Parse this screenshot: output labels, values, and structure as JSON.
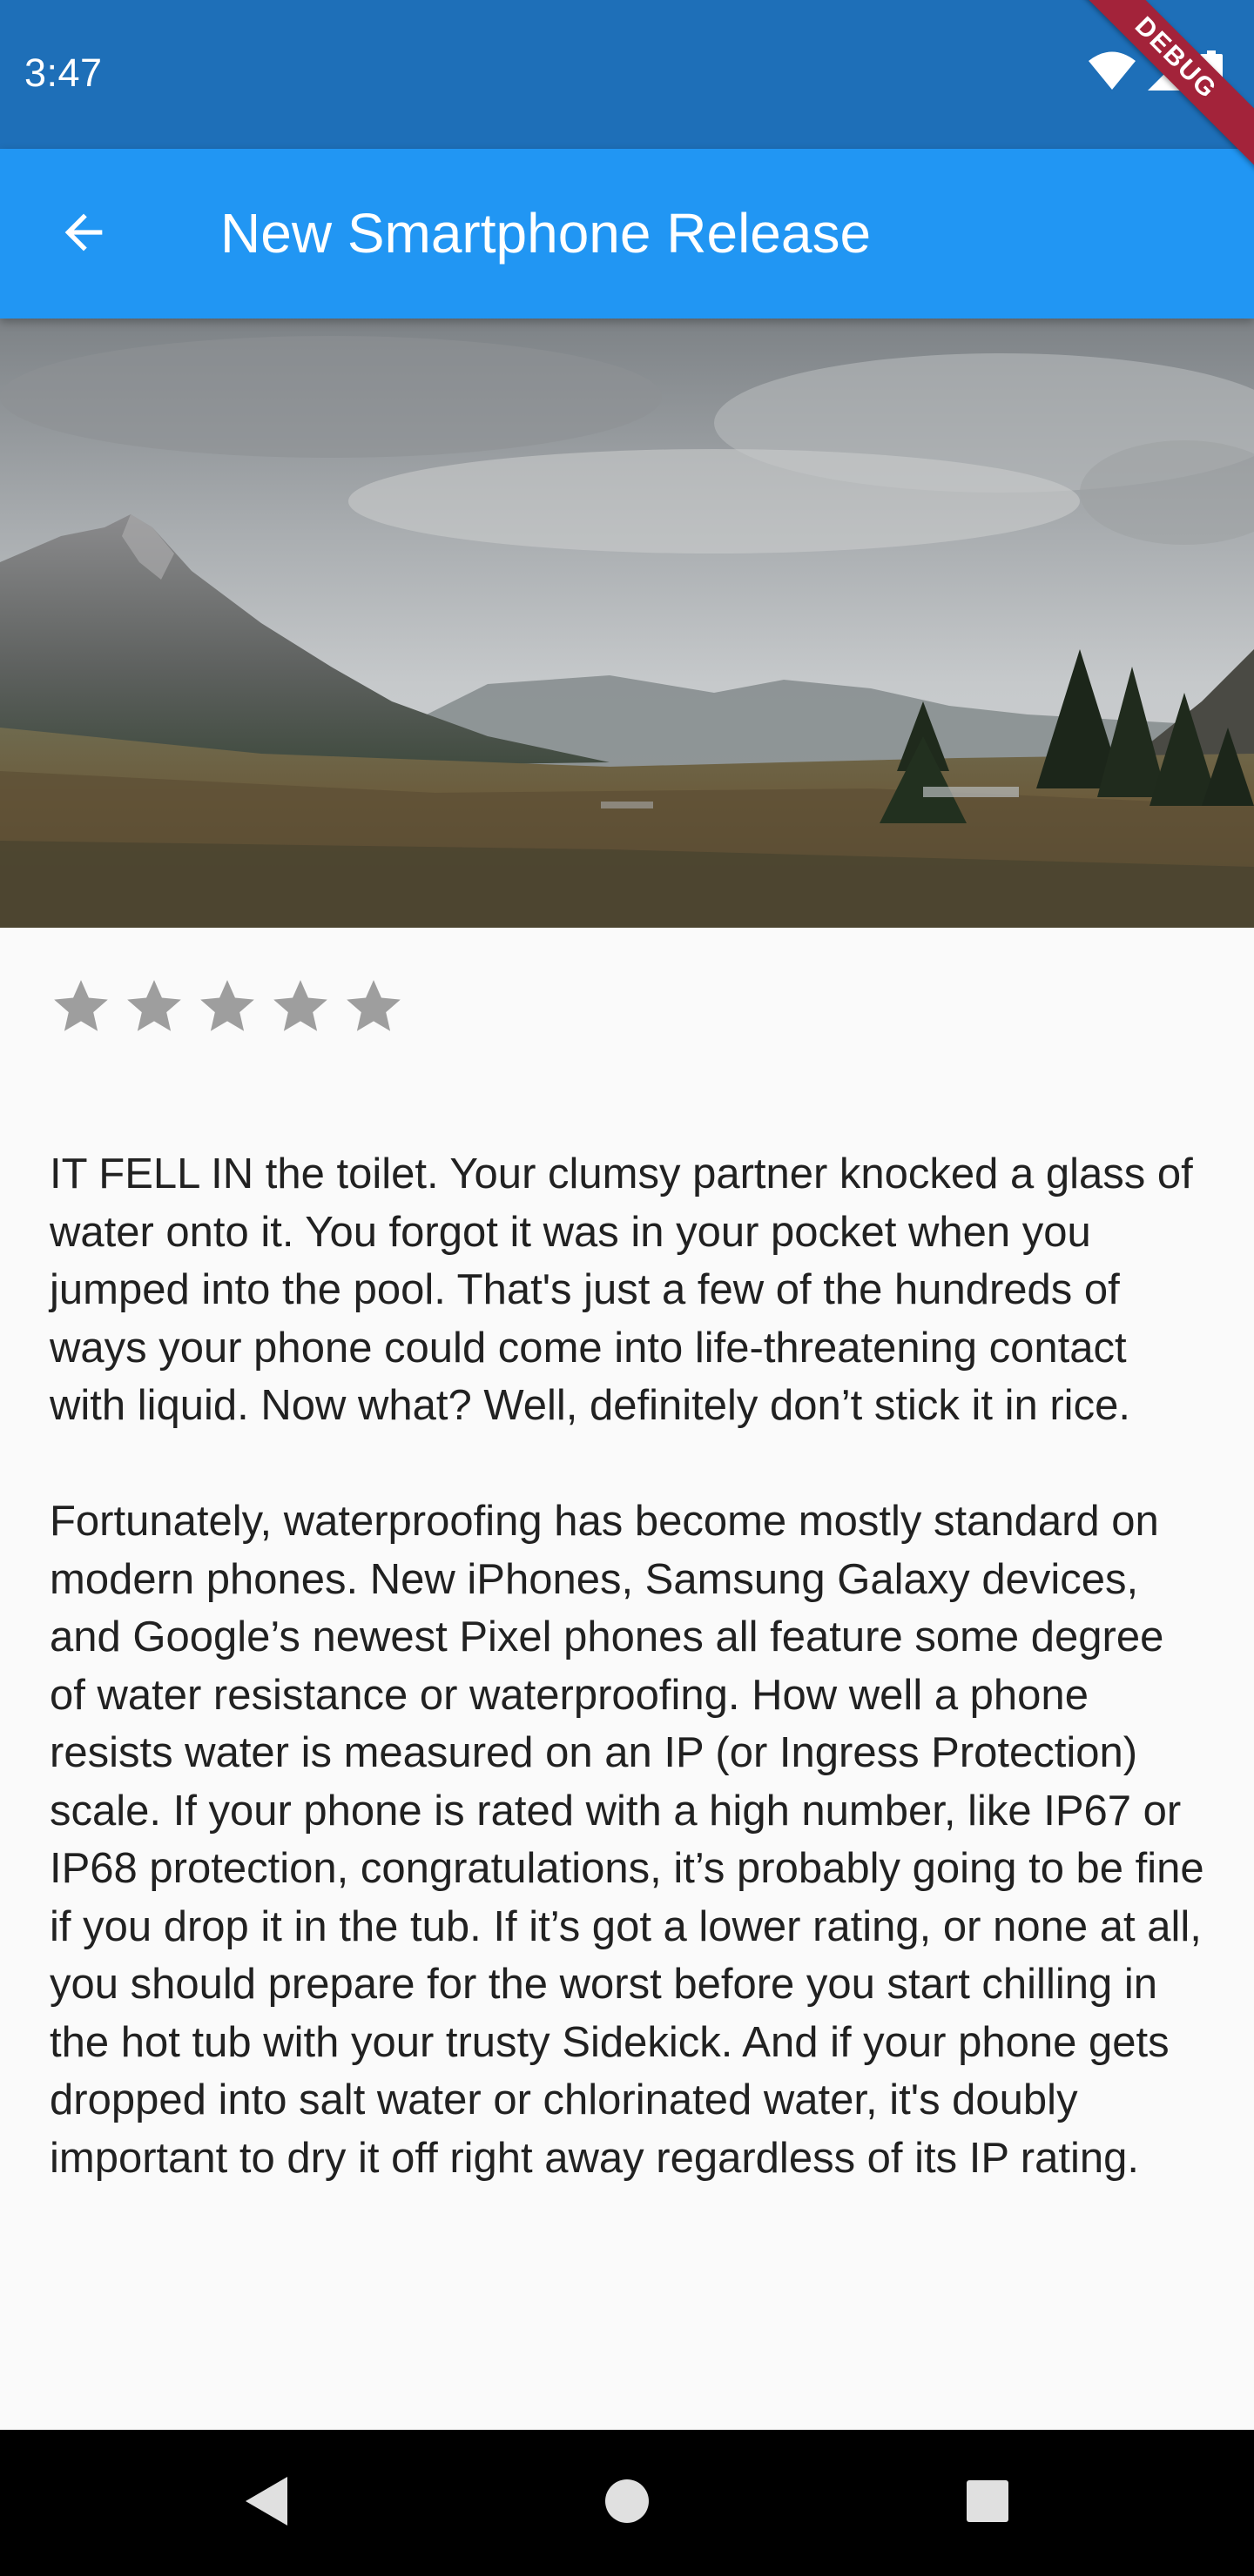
{
  "status_bar": {
    "time": "3:47",
    "icons": [
      "wifi-icon",
      "cell-signal-icon",
      "battery-icon"
    ],
    "background": "#1e6fb8"
  },
  "debug_banner": {
    "label": "DEBUG",
    "color": "#a3233a"
  },
  "app_bar": {
    "title": "New Smartphone Release",
    "back_icon": "arrow-back-icon",
    "background": "#2196f3"
  },
  "hero_image": {
    "subject": "mountain valley landscape under cloudy sky"
  },
  "rating": {
    "stars": 5,
    "filled": 0,
    "color": "#9e9e9e"
  },
  "article": {
    "paragraphs": [
      "IT FELL IN the toilet. Your clumsy partner knocked a glass of water onto it. You forgot it was in your pocket when you jumped into the pool. That's just a few of the hundreds of ways your phone could come into life-threatening contact with liquid. Now what? Well, definitely don’t stick it in rice.",
      "Fortunately, waterproofing has become mostly standard on modern phones. New iPhones, Samsung Galaxy devices, and Google’s newest Pixel phones all feature some degree of water resistance or waterproofing. How well a phone resists water is measured on an IP (or Ingress Protection) scale. If your phone is rated with a high number, like IP67 or IP68 protection, congratulations, it’s probably going to be fine if you drop it in the tub. If it’s got a lower rating, or none at all, you should prepare for the worst before you start chilling in the hot tub with your trusty Sidekick. And if your phone gets dropped into salt water or chlorinated water, it's doubly important to dry it off right away regardless of its IP rating."
    ]
  },
  "nav_bar": {
    "buttons": [
      "back-triangle-icon",
      "home-circle-icon",
      "recents-square-icon"
    ]
  }
}
